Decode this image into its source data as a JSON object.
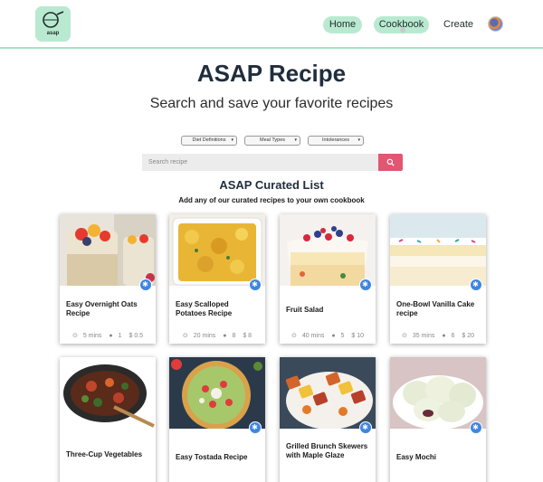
{
  "nav": {
    "logo_text": "asap",
    "home": "Home",
    "cookbook": "Cookbook",
    "create": "Create"
  },
  "header": {
    "title": "ASAP Recipe",
    "subtitle": "Search and save your favorite recipes"
  },
  "filters": {
    "diet": "Diet Definitions",
    "meal": "Meal Types",
    "intolerances": "Intolerances"
  },
  "search": {
    "placeholder": "Search recipe"
  },
  "curated": {
    "title": "ASAP Curated List",
    "subtitle": "Add any of our curated recipes to your own cookbook"
  },
  "cards": [
    {
      "name": "Easy Overnight Oats Recipe",
      "time": "5 mins",
      "servings": "1",
      "price": "$ 0.5"
    },
    {
      "name": "Easy Scalloped Potatoes Recipe",
      "time": "20 mins",
      "servings": "8",
      "price": "$ 8"
    },
    {
      "name": "Fruit Salad",
      "time": "40 mins",
      "servings": "5",
      "price": "$ 10"
    },
    {
      "name": "One-Bowl Vanilla Cake recipe",
      "time": "35 mins",
      "servings": "6",
      "price": "$ 20"
    },
    {
      "name": "Three-Cup Vegetables"
    },
    {
      "name": "Easy Tostada Recipe"
    },
    {
      "name": "Grilled Brunch Skewers with Maple Glaze"
    },
    {
      "name": "Easy Mochi"
    }
  ],
  "colors": {
    "accent_green": "#b9ead1",
    "search_button": "#e25573",
    "badge_blue": "#3e86e0"
  }
}
